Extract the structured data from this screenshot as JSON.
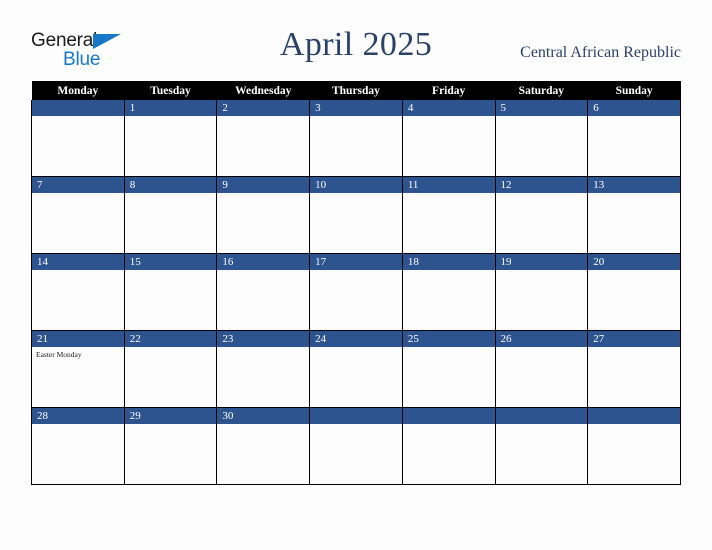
{
  "brand": {
    "name_part1": "General",
    "name_part2": "Blue",
    "triangle_icon": "triangle-icon",
    "accent_color": "#1878c8"
  },
  "header": {
    "title": "April 2025",
    "country": "Central African Republic",
    "title_color": "#2b4268"
  },
  "calendar": {
    "weekdays": [
      "Monday",
      "Tuesday",
      "Wednesday",
      "Thursday",
      "Friday",
      "Saturday",
      "Sunday"
    ],
    "header_bg": "#000000",
    "day_band_color": "#2e5490",
    "weeks": [
      [
        {
          "day": "",
          "event": ""
        },
        {
          "day": "1",
          "event": ""
        },
        {
          "day": "2",
          "event": ""
        },
        {
          "day": "3",
          "event": ""
        },
        {
          "day": "4",
          "event": ""
        },
        {
          "day": "5",
          "event": ""
        },
        {
          "day": "6",
          "event": ""
        }
      ],
      [
        {
          "day": "7",
          "event": ""
        },
        {
          "day": "8",
          "event": ""
        },
        {
          "day": "9",
          "event": ""
        },
        {
          "day": "10",
          "event": ""
        },
        {
          "day": "11",
          "event": ""
        },
        {
          "day": "12",
          "event": ""
        },
        {
          "day": "13",
          "event": ""
        }
      ],
      [
        {
          "day": "14",
          "event": ""
        },
        {
          "day": "15",
          "event": ""
        },
        {
          "day": "16",
          "event": ""
        },
        {
          "day": "17",
          "event": ""
        },
        {
          "day": "18",
          "event": ""
        },
        {
          "day": "19",
          "event": ""
        },
        {
          "day": "20",
          "event": ""
        }
      ],
      [
        {
          "day": "21",
          "event": "Easter Monday"
        },
        {
          "day": "22",
          "event": ""
        },
        {
          "day": "23",
          "event": ""
        },
        {
          "day": "24",
          "event": ""
        },
        {
          "day": "25",
          "event": ""
        },
        {
          "day": "26",
          "event": ""
        },
        {
          "day": "27",
          "event": ""
        }
      ],
      [
        {
          "day": "28",
          "event": ""
        },
        {
          "day": "29",
          "event": ""
        },
        {
          "day": "30",
          "event": ""
        },
        {
          "day": "",
          "event": ""
        },
        {
          "day": "",
          "event": ""
        },
        {
          "day": "",
          "event": ""
        },
        {
          "day": "",
          "event": ""
        }
      ]
    ]
  }
}
